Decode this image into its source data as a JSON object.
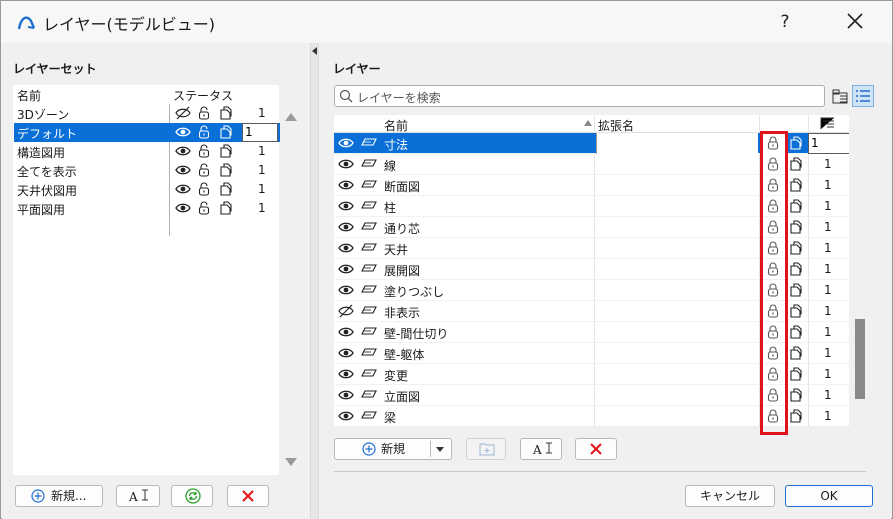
{
  "window": {
    "title": "レイヤー(モデルビュー)",
    "help_label": "?"
  },
  "left": {
    "section_title": "レイヤーセット",
    "header_name": "名前",
    "header_status": "ステータス",
    "sets": [
      {
        "name": "3Dゾーン",
        "pen": "1",
        "visible": false,
        "selected": false
      },
      {
        "name": "デフォルト",
        "pen": "1",
        "visible": true,
        "selected": true
      },
      {
        "name": "構造図用",
        "pen": "1",
        "visible": true,
        "selected": false
      },
      {
        "name": "全てを表示",
        "pen": "1",
        "visible": true,
        "selected": false
      },
      {
        "name": "天井伏図用",
        "pen": "1",
        "visible": true,
        "selected": false
      },
      {
        "name": "平面図用",
        "pen": "1",
        "visible": true,
        "selected": false
      }
    ],
    "buttons": {
      "new_label": "新規...",
      "rename_label": "A",
      "update_label": "",
      "delete_label": ""
    }
  },
  "right": {
    "section_title": "レイヤー",
    "search_placeholder": "レイヤーを検索",
    "header_name": "名前",
    "header_ext": "拡張名",
    "layers": [
      {
        "name": "寸法",
        "pen": "1",
        "visible": true,
        "selected": true
      },
      {
        "name": "線",
        "pen": "1",
        "visible": true,
        "selected": false
      },
      {
        "name": "断面図",
        "pen": "1",
        "visible": true,
        "selected": false
      },
      {
        "name": "柱",
        "pen": "1",
        "visible": true,
        "selected": false
      },
      {
        "name": "通り芯",
        "pen": "1",
        "visible": true,
        "selected": false
      },
      {
        "name": "天井",
        "pen": "1",
        "visible": true,
        "selected": false
      },
      {
        "name": "展開図",
        "pen": "1",
        "visible": true,
        "selected": false
      },
      {
        "name": "塗りつぶし",
        "pen": "1",
        "visible": true,
        "selected": false
      },
      {
        "name": "非表示",
        "pen": "1",
        "visible": false,
        "selected": false
      },
      {
        "name": "壁-間仕切り",
        "pen": "1",
        "visible": true,
        "selected": false
      },
      {
        "name": "壁-躯体",
        "pen": "1",
        "visible": true,
        "selected": false
      },
      {
        "name": "変更",
        "pen": "1",
        "visible": true,
        "selected": false
      },
      {
        "name": "立面図",
        "pen": "1",
        "visible": true,
        "selected": false
      },
      {
        "name": "梁",
        "pen": "1",
        "visible": true,
        "selected": false
      }
    ],
    "buttons": {
      "new_label": "新規",
      "rename_label": "A"
    }
  },
  "footer": {
    "cancel_label": "キャンセル",
    "ok_label": "OK"
  },
  "colors": {
    "selection": "#0a6fd6",
    "highlight": "#e0121b",
    "update_icon": "#2aa12a",
    "delete_icon": "#e0121b"
  }
}
